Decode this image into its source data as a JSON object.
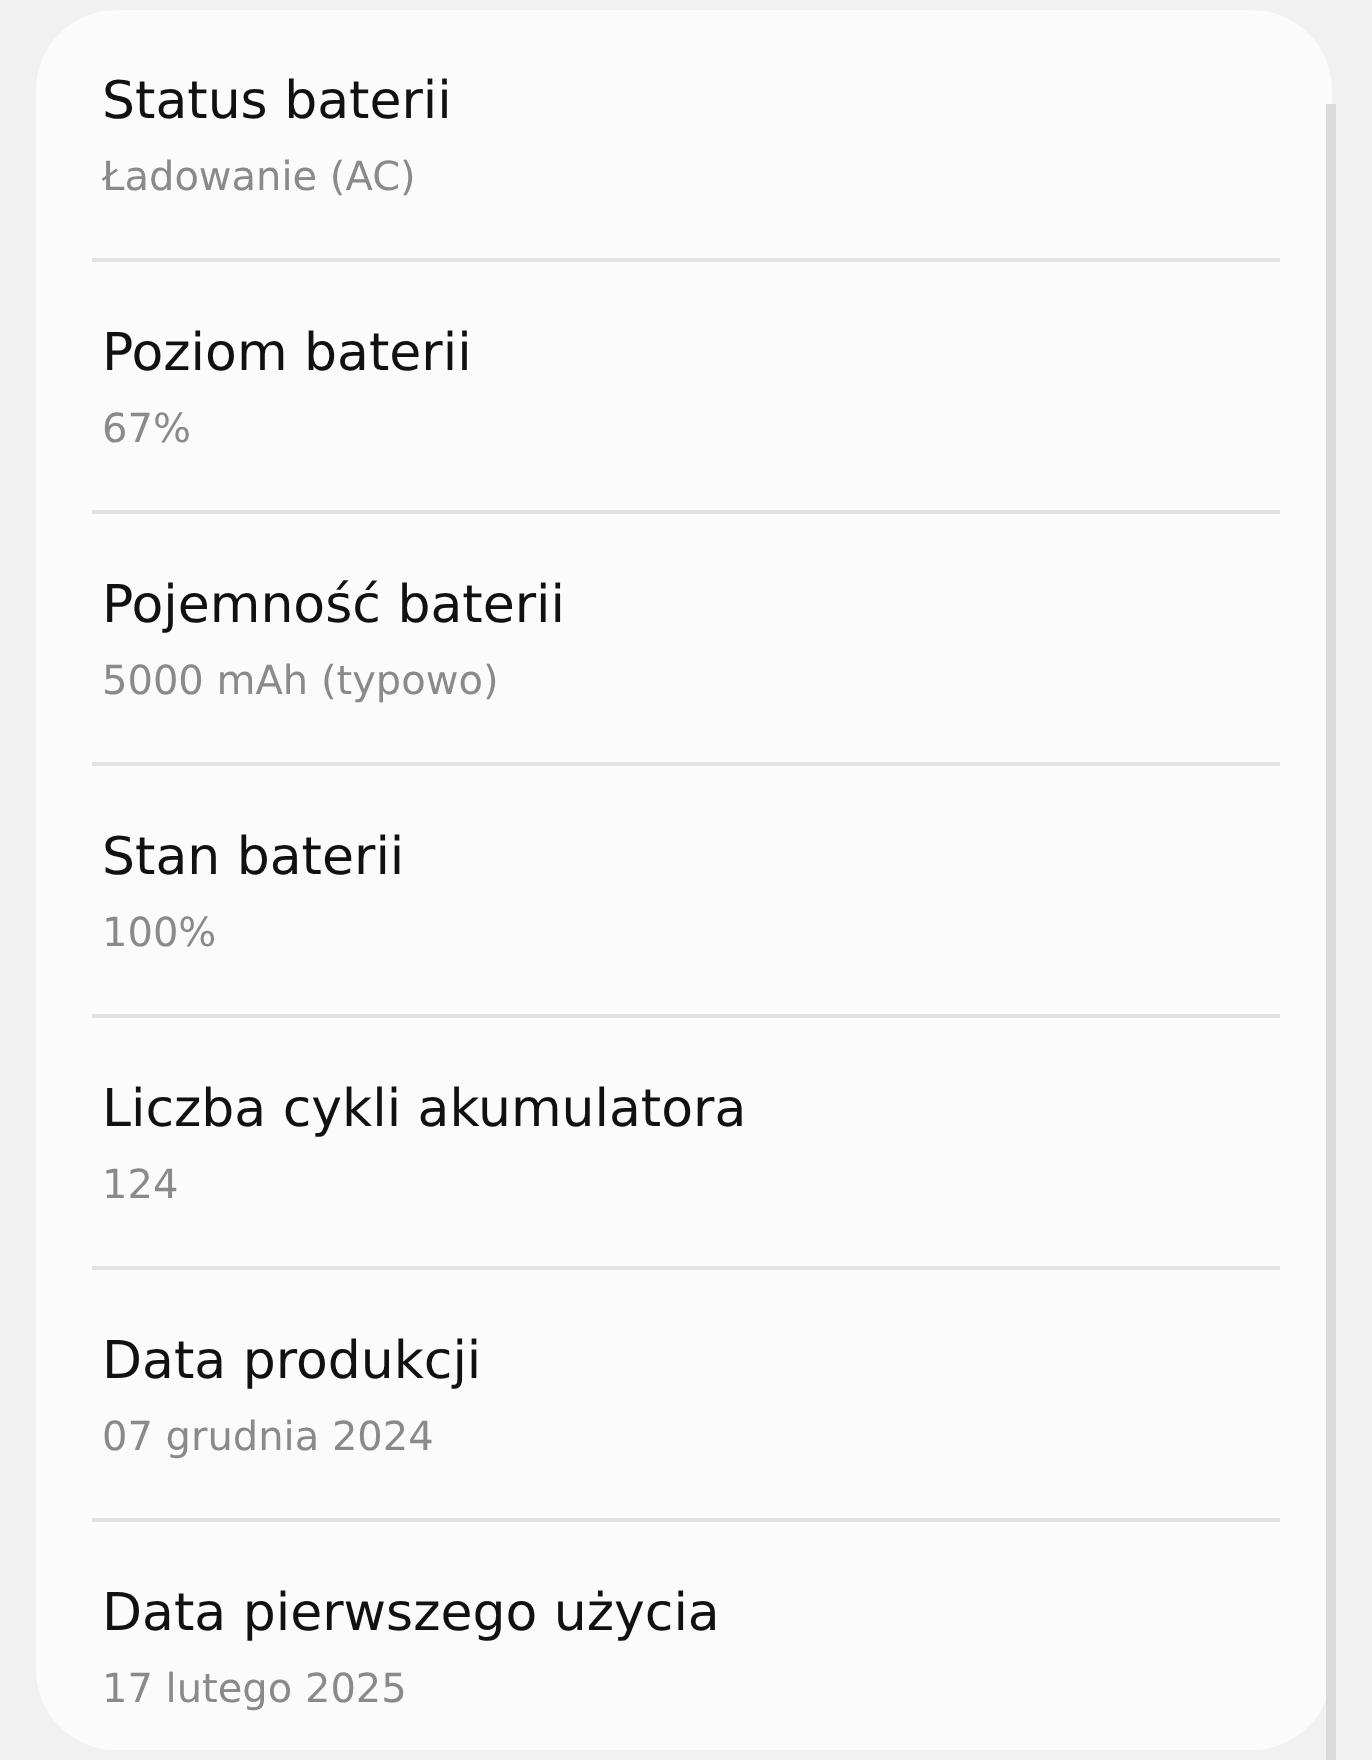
{
  "items": [
    {
      "title": "Status baterii",
      "value": "Ładowanie (AC)"
    },
    {
      "title": "Poziom baterii",
      "value": "67%"
    },
    {
      "title": "Pojemność baterii",
      "value": "5000 mAh (typowo)"
    },
    {
      "title": "Stan baterii",
      "value": "100%"
    },
    {
      "title": "Liczba cykli akumulatora",
      "value": "124"
    },
    {
      "title": "Data produkcji",
      "value": "07 grudnia 2024"
    },
    {
      "title": "Data pierwszego użycia",
      "value": "17 lutego 2025"
    }
  ]
}
